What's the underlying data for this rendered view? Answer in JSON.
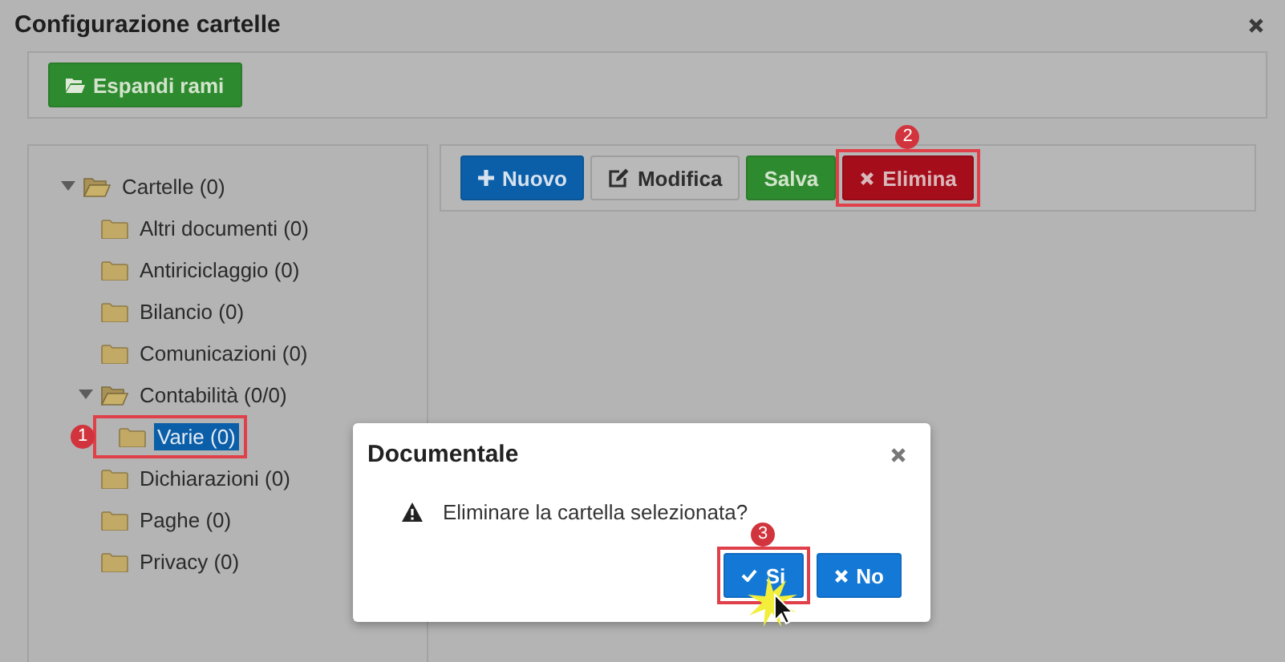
{
  "window": {
    "title": "Configurazione cartelle"
  },
  "toolbar": {
    "buttons": [
      {
        "label": "Espandi rami",
        "kind": "success"
      }
    ]
  },
  "tree": {
    "items": [
      {
        "label": "Cartelle (0)",
        "expanded": true,
        "selected": false,
        "highlighted": false,
        "children": [
          {
            "label": "Altri documenti (0)",
            "selected": false,
            "highlighted": false
          },
          {
            "label": "Antiriciclaggio (0)",
            "selected": false,
            "highlighted": false
          },
          {
            "label": "Bilancio (0)",
            "selected": false,
            "highlighted": false
          },
          {
            "label": "Comunicazioni (0)",
            "selected": false,
            "highlighted": false
          },
          {
            "label": "Contabilità (0/0)",
            "expanded": true,
            "selected": false,
            "highlighted": false,
            "children": [
              {
                "label": "Varie (0)",
                "selected": true,
                "highlighted": true,
                "callout": "1"
              }
            ]
          },
          {
            "label": "Dichiarazioni (0)",
            "selected": false,
            "highlighted": false
          },
          {
            "label": "Paghe (0)",
            "selected": false,
            "highlighted": false
          },
          {
            "label": "Privacy (0)",
            "selected": false,
            "highlighted": false
          }
        ]
      }
    ]
  },
  "actions": {
    "buttons": [
      {
        "label": "Nuovo",
        "kind": "primary",
        "highlighted": false
      },
      {
        "label": "Modifica",
        "kind": "default",
        "highlighted": false
      },
      {
        "label": "Salva",
        "kind": "success",
        "highlighted": false
      },
      {
        "label": "Elimina",
        "kind": "danger",
        "highlighted": true,
        "callout": "2"
      }
    ]
  },
  "dialog": {
    "title": "Documentale",
    "message": "Eliminare la cartella selezionata?",
    "buttons": [
      {
        "label": "Si",
        "highlighted": true,
        "callout": "3",
        "clicked": true
      },
      {
        "label": "No",
        "highlighted": false,
        "clicked": false
      }
    ]
  }
}
